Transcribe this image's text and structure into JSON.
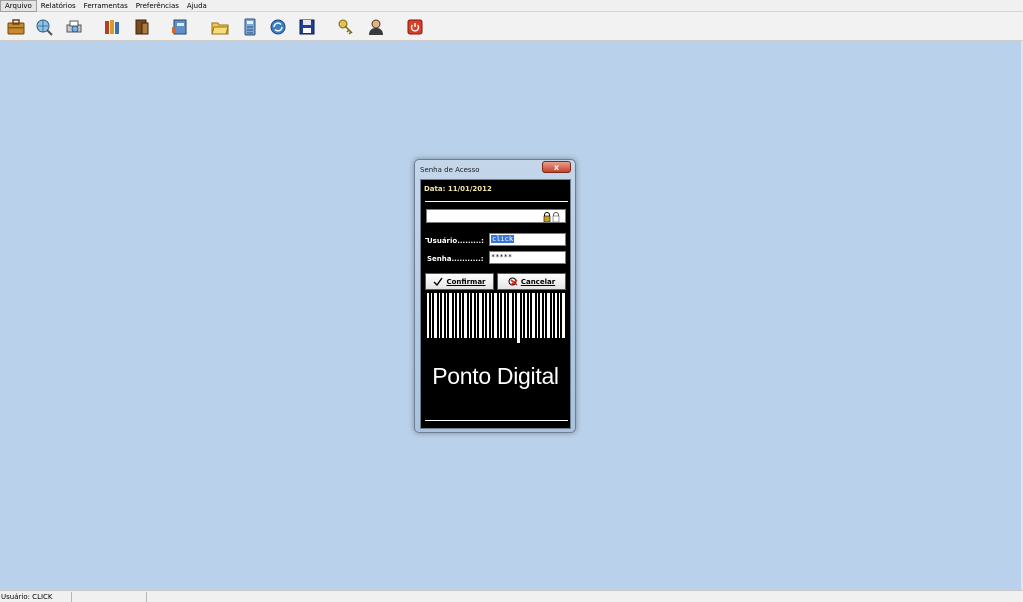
{
  "menu": {
    "items": [
      "Arquivo",
      "Relatórios",
      "Ferramentas",
      "Preferências",
      "Ajuda"
    ]
  },
  "toolbar": {
    "icons": [
      "briefcase-icon",
      "globe-search-icon",
      "printer-search-icon",
      "books-icon",
      "book-icon",
      "notebook-icon",
      "folder-open-icon",
      "calculator-icon",
      "refresh-icon",
      "floppy-save-icon",
      "keys-icon",
      "user-icon",
      "power-icon"
    ]
  },
  "dialog": {
    "title": "Senha de Acesso",
    "close_label": "x",
    "date": "Data: 11/01/2012",
    "username_label": "Usuário.........:",
    "username_value": "click",
    "password_label": "Senha...........:",
    "password_value": "*****",
    "confirm_label": "Confirmar",
    "cancel_label": "Cancelar",
    "brand": "Ponto Digital"
  },
  "status": {
    "user": "Usuário: CLICK"
  },
  "colors": {
    "desktop": "#b9d1ea",
    "dialog_bg": "#000000",
    "date_text": "#f2e6a8",
    "selection": "#3875d7"
  }
}
